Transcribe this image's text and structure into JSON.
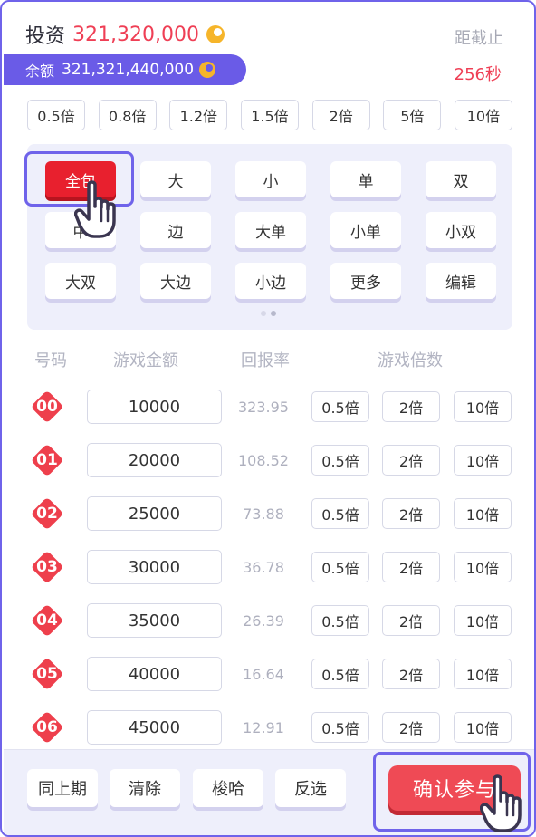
{
  "header": {
    "invest_label": "投资",
    "invest_amount": "321,320,000",
    "deadline_label": "距截止",
    "balance_label": "余额",
    "balance_amount": "321,321,440,000",
    "countdown": "256秒"
  },
  "multipliers": [
    "0.5倍",
    "0.8倍",
    "1.2倍",
    "1.5倍",
    "2倍",
    "5倍",
    "10倍"
  ],
  "quick_select": {
    "buttons": [
      "全包",
      "大",
      "小",
      "单",
      "双",
      "中",
      "边",
      "大单",
      "小单",
      "小双",
      "大双",
      "大边",
      "小边",
      "更多",
      "编辑"
    ],
    "active": "全包",
    "pages": 2,
    "current_page": 1
  },
  "table": {
    "headers": [
      "号码",
      "游戏金额",
      "回报率",
      "游戏倍数"
    ],
    "rows": [
      {
        "number": "00",
        "amount": "10000",
        "rate": "323.95",
        "mults": [
          "0.5倍",
          "2倍",
          "10倍"
        ]
      },
      {
        "number": "01",
        "amount": "20000",
        "rate": "108.52",
        "mults": [
          "0.5倍",
          "2倍",
          "10倍"
        ]
      },
      {
        "number": "02",
        "amount": "25000",
        "rate": "73.88",
        "mults": [
          "0.5倍",
          "2倍",
          "10倍"
        ]
      },
      {
        "number": "03",
        "amount": "30000",
        "rate": "36.78",
        "mults": [
          "0.5倍",
          "2倍",
          "10倍"
        ]
      },
      {
        "number": "04",
        "amount": "35000",
        "rate": "26.39",
        "mults": [
          "0.5倍",
          "2倍",
          "10倍"
        ]
      },
      {
        "number": "05",
        "amount": "40000",
        "rate": "16.64",
        "mults": [
          "0.5倍",
          "2倍",
          "10倍"
        ]
      },
      {
        "number": "06",
        "amount": "45000",
        "rate": "12.91",
        "mults": [
          "0.5倍",
          "2倍",
          "10倍"
        ]
      }
    ]
  },
  "footer": {
    "buttons": [
      "同上期",
      "清除",
      "梭哈",
      "反选"
    ],
    "confirm_label": "确认参与"
  },
  "colors": {
    "accent": "#6f63ea",
    "danger": "#ef3f55",
    "coin": "#f6b52a",
    "panel": "#eeeffb"
  },
  "icons": {
    "coin": "coin-icon",
    "pointer": "hand-pointer-icon"
  }
}
